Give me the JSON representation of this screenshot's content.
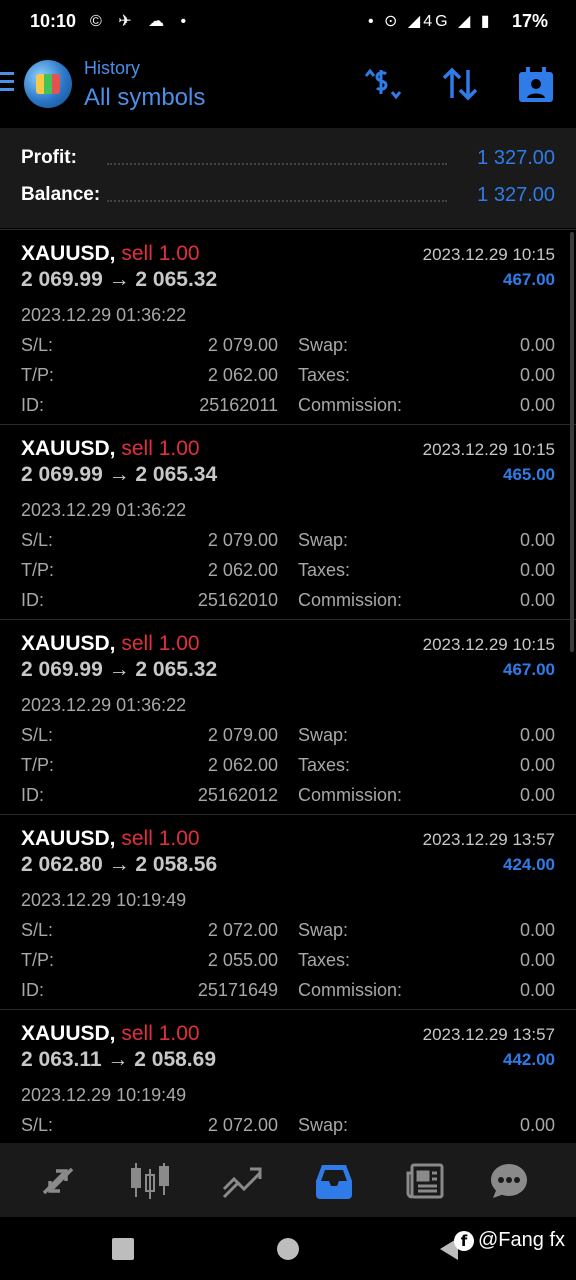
{
  "status_bar": {
    "time": "10:10",
    "left_icons": "© ✈ ☁ •",
    "right_icons": "• ⊙ ◢4G ◢ ▮",
    "battery": "17%"
  },
  "header": {
    "subtitle": "History",
    "title": "All symbols",
    "accent_color": "#2f7ce8"
  },
  "summary": {
    "profit_label": "Profit:",
    "profit_value": "1 327.00",
    "balance_label": "Balance:",
    "balance_value": "1 327.00"
  },
  "deals": [
    {
      "symbol": "XAUUSD,",
      "side": "sell 1.00",
      "close_time": "2023.12.29 10:15",
      "prices": "2 069.99 → 2 065.32",
      "profit": "467.00",
      "open_time": "2023.12.29 01:36:22",
      "sl_label": "S/L:",
      "sl": "2 079.00",
      "swap_label": "Swap:",
      "swap": "0.00",
      "tp_label": "T/P:",
      "tp": "2 062.00",
      "taxes_label": "Taxes:",
      "taxes": "0.00",
      "id_label": "ID:",
      "id": "25162011",
      "commission_label": "Commission:",
      "commission": "0.00"
    },
    {
      "symbol": "XAUUSD,",
      "side": "sell 1.00",
      "close_time": "2023.12.29 10:15",
      "prices": "2 069.99 → 2 065.34",
      "profit": "465.00",
      "open_time": "2023.12.29 01:36:22",
      "sl_label": "S/L:",
      "sl": "2 079.00",
      "swap_label": "Swap:",
      "swap": "0.00",
      "tp_label": "T/P:",
      "tp": "2 062.00",
      "taxes_label": "Taxes:",
      "taxes": "0.00",
      "id_label": "ID:",
      "id": "25162010",
      "commission_label": "Commission:",
      "commission": "0.00"
    },
    {
      "symbol": "XAUUSD,",
      "side": "sell 1.00",
      "close_time": "2023.12.29 10:15",
      "prices": "2 069.99 → 2 065.32",
      "profit": "467.00",
      "open_time": "2023.12.29 01:36:22",
      "sl_label": "S/L:",
      "sl": "2 079.00",
      "swap_label": "Swap:",
      "swap": "0.00",
      "tp_label": "T/P:",
      "tp": "2 062.00",
      "taxes_label": "Taxes:",
      "taxes": "0.00",
      "id_label": "ID:",
      "id": "25162012",
      "commission_label": "Commission:",
      "commission": "0.00"
    },
    {
      "symbol": "XAUUSD,",
      "side": "sell 1.00",
      "close_time": "2023.12.29 13:57",
      "prices": "2 062.80 → 2 058.56",
      "profit": "424.00",
      "open_time": "2023.12.29 10:19:49",
      "sl_label": "S/L:",
      "sl": "2 072.00",
      "swap_label": "Swap:",
      "swap": "0.00",
      "tp_label": "T/P:",
      "tp": "2 055.00",
      "taxes_label": "Taxes:",
      "taxes": "0.00",
      "id_label": "ID:",
      "id": "25171649",
      "commission_label": "Commission:",
      "commission": "0.00"
    },
    {
      "symbol": "XAUUSD,",
      "side": "sell 1.00",
      "close_time": "2023.12.29 13:57",
      "prices": "2 063.11 → 2 058.69",
      "profit": "442.00",
      "open_time": "2023.12.29 10:19:49",
      "sl_label": "S/L:",
      "sl": "2 072.00",
      "swap_label": "Swap:",
      "swap": "0.00"
    }
  ],
  "watermark": {
    "fb_glyph": "f",
    "handle": "@Fang fx"
  }
}
